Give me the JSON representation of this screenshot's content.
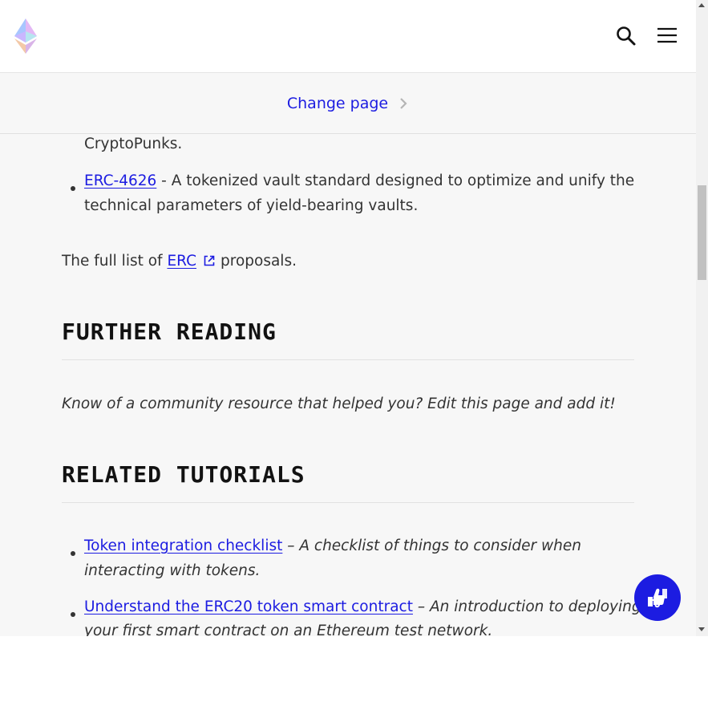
{
  "header": {
    "logo_icon": "ethereum-logo-icon",
    "search_icon": "search-icon",
    "menu_icon": "hamburger-menu-icon"
  },
  "change_page": {
    "label": "Change page",
    "icon": "chevron-right-icon"
  },
  "content": {
    "erc721_tail": "CryptoPunks.",
    "erc4626_link": "ERC-4626",
    "erc4626_text_1": " - A tokenized vault standard designed to optimize and unify the",
    "erc4626_text_2": "technical parameters of yield-bearing vaults.",
    "full_list_prefix": "The full list of ",
    "full_list_link": "ERC",
    "full_list_suffix": "proposals.",
    "further_reading_heading": "FURTHER READING",
    "further_reading_text": "Know of a community resource that helped you? Edit this page and add it!",
    "related_tutorials_heading": "RELATED TUTORIALS",
    "tutorials": [
      {
        "link": "Token integration checklist",
        "desc_1": " – A checklist of things to consider when",
        "desc_2": "interacting with tokens."
      },
      {
        "link": "Understand the ERC20 token smart contract",
        "desc_1": " – An introduction to deploying",
        "desc_2": "your first smart contract on an Ethereum test network."
      }
    ]
  },
  "feedback": {
    "icon": "thumbs-feedback-icon"
  },
  "colors": {
    "link": "#1c1ce1",
    "background": "#f7f7f7",
    "text": "#333333",
    "heading": "#121212"
  }
}
